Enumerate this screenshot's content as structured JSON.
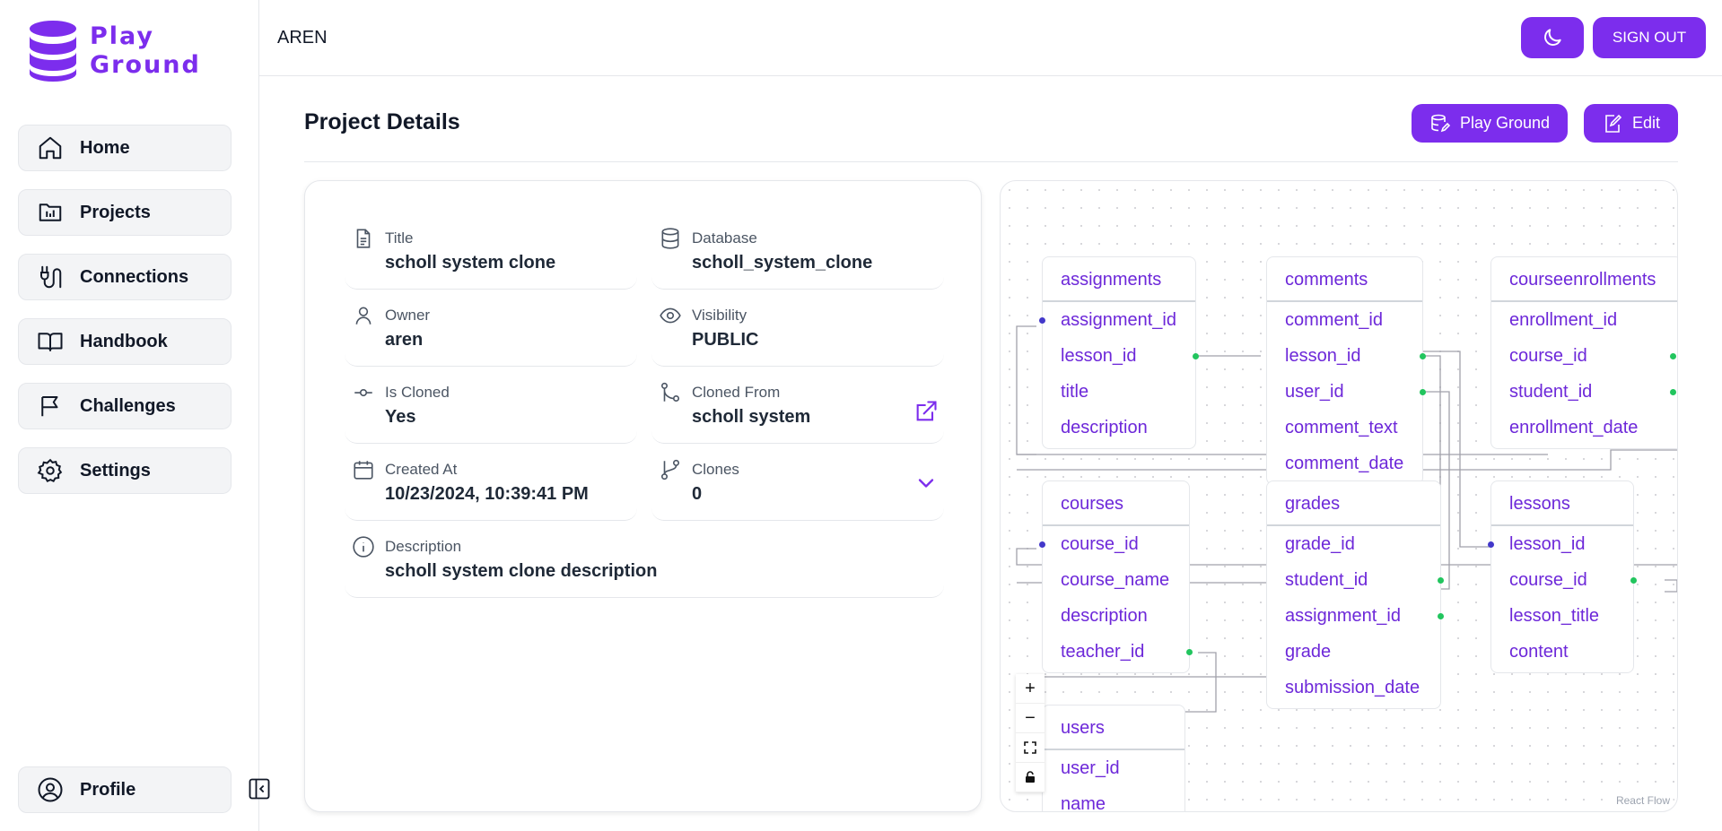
{
  "app": {
    "logo_line1": "Play",
    "logo_line2": "Ground"
  },
  "sidebar": {
    "items": [
      {
        "label": "Home",
        "icon": "home-icon"
      },
      {
        "label": "Projects",
        "icon": "folder-chart-icon"
      },
      {
        "label": "Connections",
        "icon": "plug-icon"
      },
      {
        "label": "Handbook",
        "icon": "book-icon"
      },
      {
        "label": "Challenges",
        "icon": "flag-icon"
      },
      {
        "label": "Settings",
        "icon": "gear-icon"
      }
    ],
    "profile_label": "Profile"
  },
  "topbar": {
    "user": "AREN",
    "signout_label": "SIGN OUT"
  },
  "header": {
    "title": "Project Details",
    "playground_label": "Play Ground",
    "edit_label": "Edit"
  },
  "details": {
    "title": {
      "label": "Title",
      "value": "scholl system clone"
    },
    "database": {
      "label": "Database",
      "value": "scholl_system_clone"
    },
    "owner": {
      "label": "Owner",
      "value": "aren"
    },
    "visibility": {
      "label": "Visibility",
      "value": "PUBLIC"
    },
    "is_cloned": {
      "label": "Is Cloned",
      "value": "Yes"
    },
    "cloned_from": {
      "label": "Cloned From",
      "value": "scholl system"
    },
    "created_at": {
      "label": "Created At",
      "value": "10/23/2024, 10:39:41 PM"
    },
    "clones": {
      "label": "Clones",
      "value": "0"
    },
    "description": {
      "label": "Description",
      "value": "scholl system clone description"
    }
  },
  "diagram": {
    "tables": [
      {
        "name": "assignments",
        "columns": [
          "assignment_id",
          "lesson_id",
          "title",
          "description"
        ]
      },
      {
        "name": "comments",
        "columns": [
          "comment_id",
          "lesson_id",
          "user_id",
          "comment_text",
          "comment_date"
        ]
      },
      {
        "name": "courseenrollments",
        "columns": [
          "enrollment_id",
          "course_id",
          "student_id",
          "enrollment_date"
        ]
      },
      {
        "name": "courses",
        "columns": [
          "course_id",
          "course_name",
          "description",
          "teacher_id"
        ]
      },
      {
        "name": "grades",
        "columns": [
          "grade_id",
          "student_id",
          "assignment_id",
          "grade",
          "submission_date"
        ]
      },
      {
        "name": "lessons",
        "columns": [
          "lesson_id",
          "course_id",
          "lesson_title",
          "content"
        ]
      },
      {
        "name": "users",
        "columns": [
          "user_id",
          "name"
        ]
      }
    ],
    "controls": {
      "zoom_in": "+",
      "zoom_out": "−"
    },
    "attribution": "React Flow"
  },
  "colors": {
    "accent": "#7c2ded",
    "table_text": "#6d28d9",
    "handle_source": "#22c55e",
    "handle_target": "#4338ca"
  }
}
